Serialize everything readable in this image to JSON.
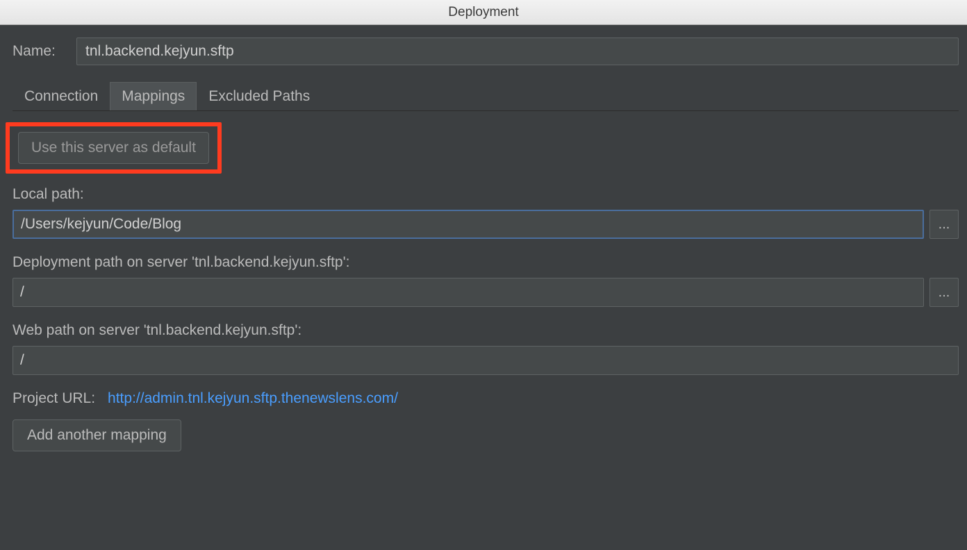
{
  "window": {
    "title": "Deployment"
  },
  "name": {
    "label": "Name:",
    "value": "tnl.backend.kejyun.sftp"
  },
  "tabs": {
    "connection": "Connection",
    "mappings": "Mappings",
    "excluded": "Excluded Paths",
    "active": "mappings"
  },
  "mappings": {
    "default_server_button": "Use this server as default",
    "local_path_label": "Local path:",
    "local_path_value": "/Users/kejyun/Code/Blog",
    "deployment_path_label": "Deployment path on server 'tnl.backend.kejyun.sftp':",
    "deployment_path_value": "/",
    "web_path_label": "Web path on server 'tnl.backend.kejyun.sftp':",
    "web_path_value": "/",
    "project_url_label": "Project URL:",
    "project_url_value": "http://admin.tnl.kejyun.sftp.thenewslens.com/",
    "add_mapping_button": "Add another mapping",
    "browse_button": "..."
  }
}
